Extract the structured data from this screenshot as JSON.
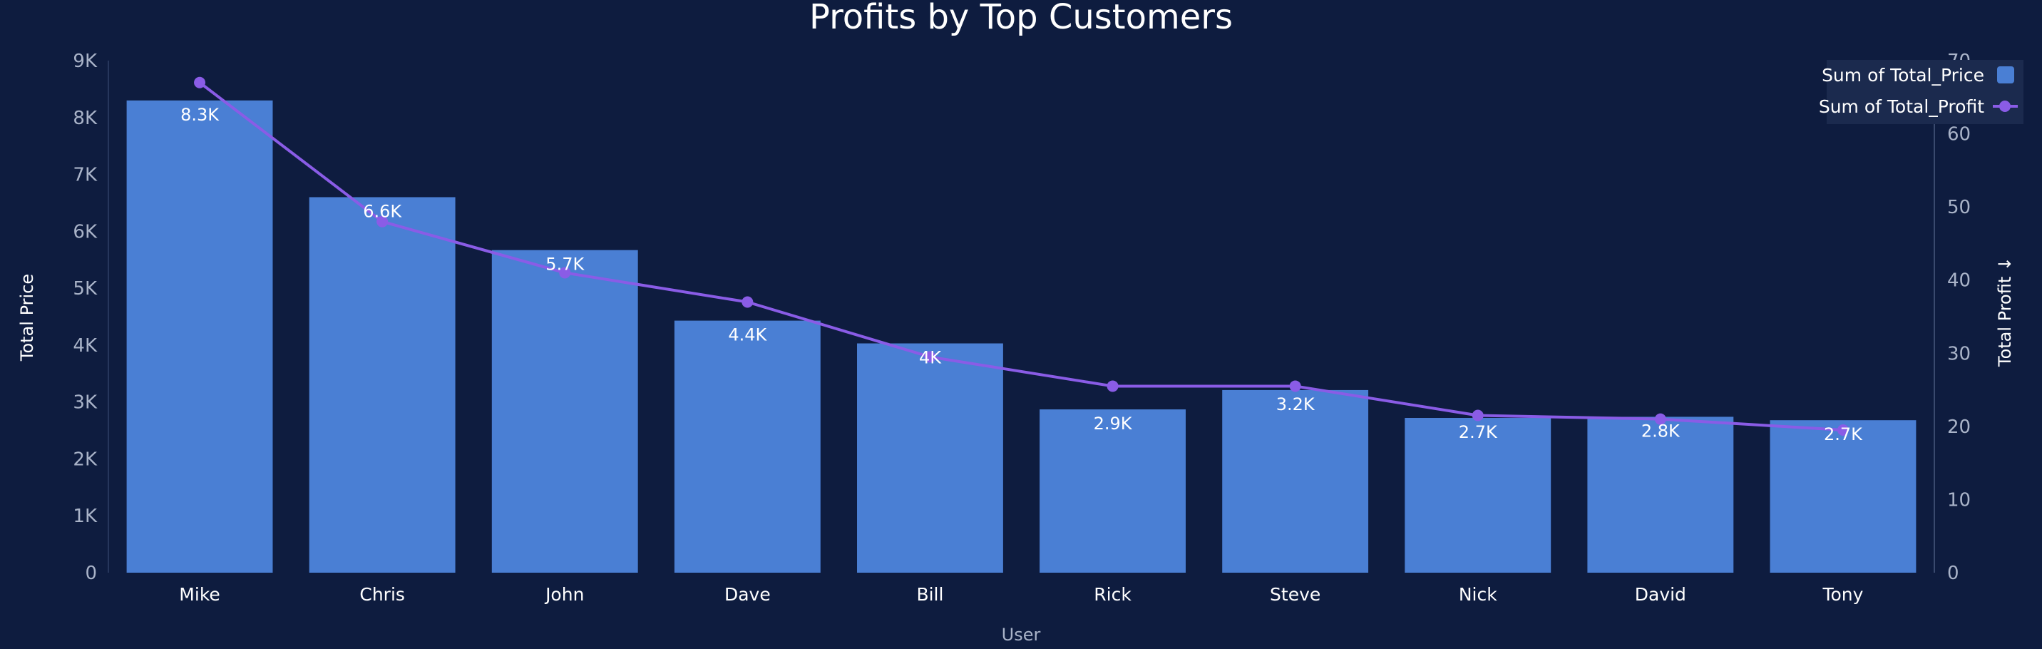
{
  "chart_data": {
    "type": "bar",
    "title": "Profits by Top Customers",
    "xlabel": "User",
    "ylabel": "Total Price",
    "ylabel_right": "Total Profit ↓",
    "categories": [
      "Mike",
      "Chris",
      "John",
      "Dave",
      "Bill",
      "Rick",
      "Steve",
      "Nick",
      "David",
      "Tony"
    ],
    "series": [
      {
        "name": "Sum of Total_Price",
        "type": "bar",
        "axis": "left",
        "values": [
          8300,
          6600,
          5670,
          4430,
          4030,
          2870,
          3210,
          2720,
          2740,
          2680
        ],
        "labels": [
          "8.3K",
          "6.6K",
          "5.7K",
          "4.4K",
          "4K",
          "2.9K",
          "3.2K",
          "2.7K",
          "2.8K",
          "2.7K"
        ]
      },
      {
        "name": "Sum of Total_Profit",
        "type": "line",
        "axis": "right",
        "values": [
          67,
          48,
          41,
          37,
          29.5,
          25.5,
          25.5,
          21.5,
          21,
          19.5
        ]
      }
    ],
    "ylim": [
      0,
      9000
    ],
    "y_ticks": [
      "0",
      "1K",
      "2K",
      "3K",
      "4K",
      "5K",
      "6K",
      "7K",
      "8K",
      "9K"
    ],
    "y2lim": [
      0,
      70
    ],
    "y2_ticks": [
      "0",
      "10",
      "20",
      "30",
      "40",
      "50",
      "60",
      "70"
    ],
    "legend_position": "top-right",
    "colors": {
      "bar": "#4a7fd4",
      "line": "#8a5ce6",
      "background": "#0e1c3f"
    }
  }
}
